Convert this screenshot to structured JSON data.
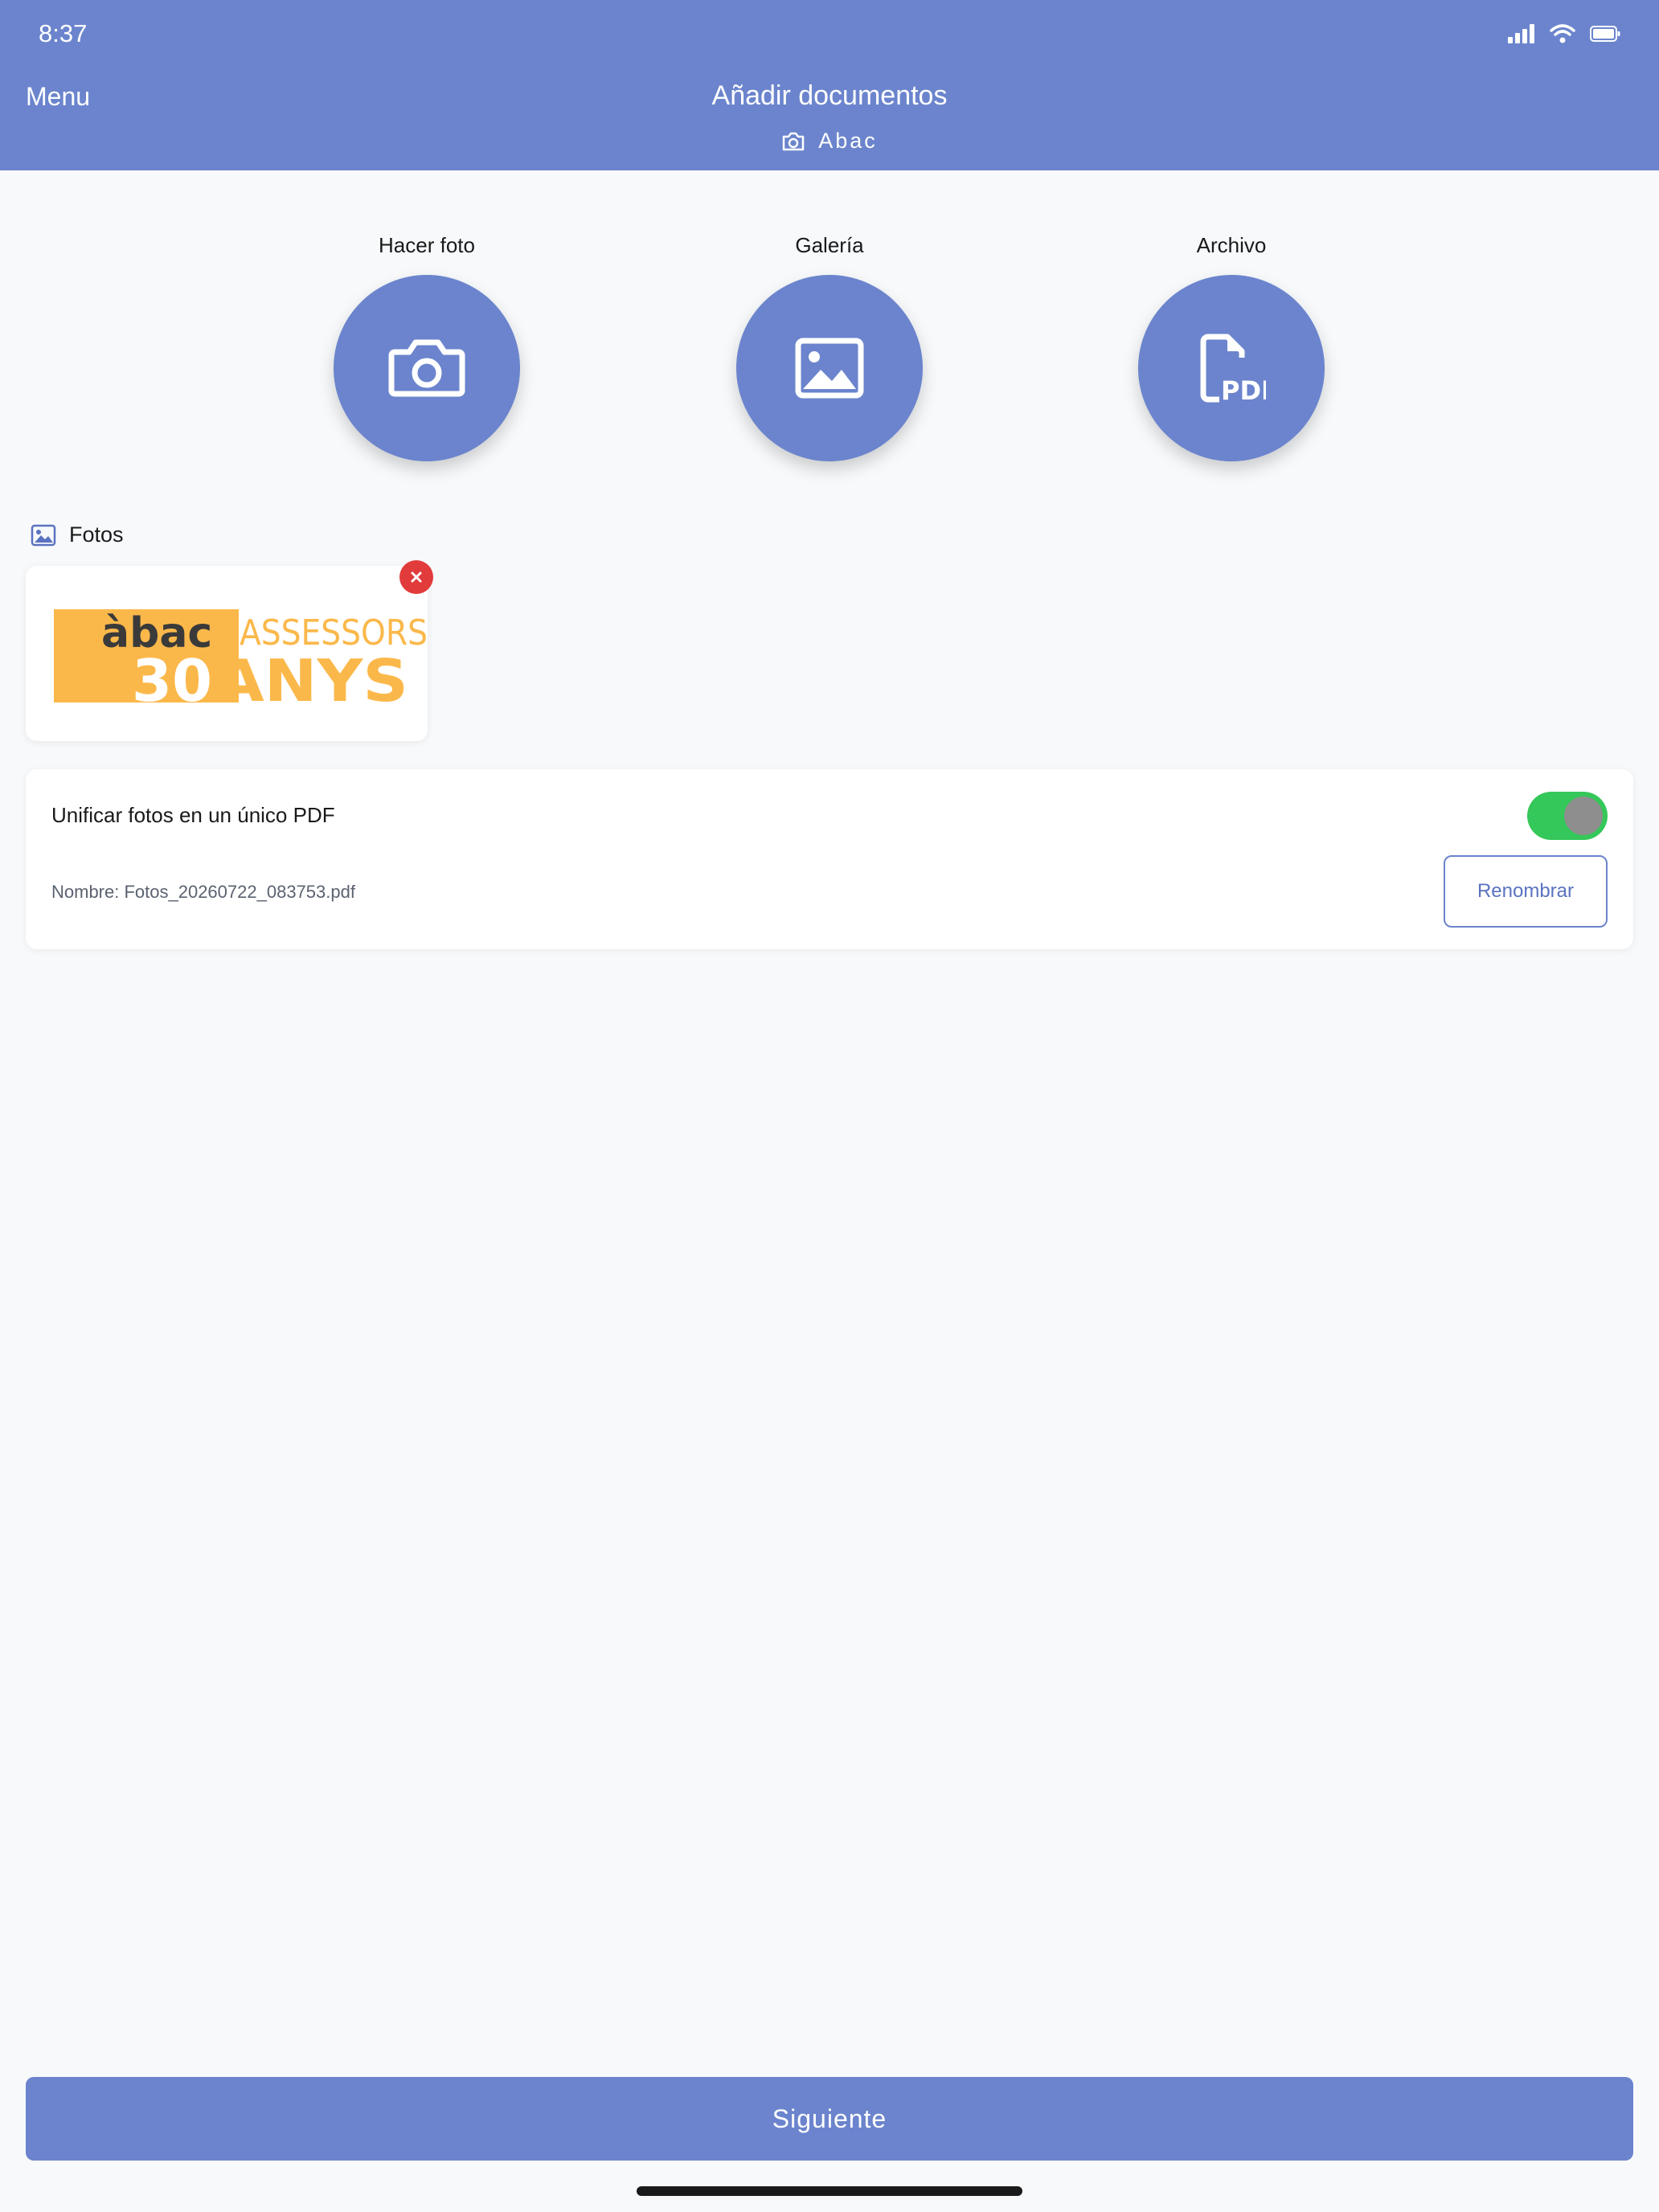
{
  "status_bar": {
    "time": "8:37",
    "icons": [
      "signal-icon",
      "wifi-icon",
      "battery-icon"
    ]
  },
  "header": {
    "menu_label": "Menu",
    "title": "Añadir documentos",
    "subtitle": "Abac",
    "subtitle_icon": "camera-icon",
    "background": "#6b84cd"
  },
  "actions": [
    {
      "label": "Hacer foto",
      "icon": "camera-icon"
    },
    {
      "label": "Galería",
      "icon": "image-icon"
    },
    {
      "label": "Archivo",
      "icon": "pdf-file-icon"
    }
  ],
  "photos_section": {
    "title": "Fotos",
    "icon": "image-icon",
    "items": [
      {
        "thumbnail_logo": {
          "brand": "àbac",
          "tagline": "ASSESSORS",
          "number": "30",
          "word": "ANYS"
        }
      }
    ]
  },
  "options": {
    "unify_label": "Unificar fotos en un único PDF",
    "unify_enabled": true,
    "filename_text": "Nombre: Fotos_20260722_083753.pdf",
    "rename_label": "Renombrar"
  },
  "footer": {
    "next_label": "Siguiente"
  },
  "colors": {
    "accent": "#6b84cd",
    "toggle_on": "#34c759",
    "danger": "#e23b3b",
    "logo_orange": "#fbb84a"
  }
}
